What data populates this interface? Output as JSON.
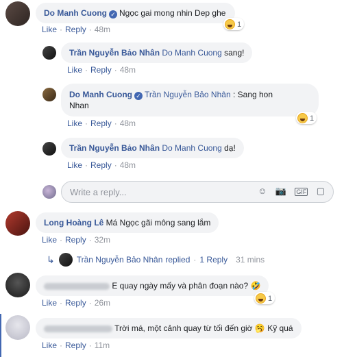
{
  "actions": {
    "like": "Like",
    "reply": "Reply"
  },
  "comments": [
    {
      "author": "Do Manh Cuong",
      "text": "Ngọc gai mong nhin Dep ghe",
      "time": "48m",
      "reaction_count": "1"
    },
    {
      "author": "Trần Nguyễn Bảo Nhân",
      "mention": "Do Manh Cuong",
      "text": "sang!",
      "time": "48m"
    },
    {
      "author": "Do Manh Cuong",
      "mention": "Trần Nguyễn Bảo Nhân",
      "text_line1": ": Sang hon",
      "text_line2": "Nhan",
      "time": "48m",
      "reaction_count": "1"
    },
    {
      "author": "Trần Nguyễn Bảo Nhân",
      "mention": "Do Manh Cuong",
      "text": "dạ!",
      "time": "48m"
    },
    {
      "author": "Long Hoàng Lê",
      "text": "Má Ngọc gãi mông sang lắm",
      "time": "32m"
    },
    {
      "text": "E quay ngày mấy và phân đoạn nào?",
      "time": "26m",
      "reaction_count": "1"
    },
    {
      "text": "Trời má, một cảnh quay từ tối đến giờ",
      "text_after": "Kỹ quá",
      "time": "11m"
    }
  ],
  "reply_box": {
    "placeholder": "Write a reply...",
    "icons": [
      "emoji-icon",
      "camera-icon",
      "gif-icon",
      "sticker-icon"
    ]
  },
  "replies_summary": {
    "author": "Trần Nguyễn Bảo Nhân",
    "verb": "replied",
    "separator": "·",
    "count_label": "1 Reply",
    "time": "31 mins"
  },
  "colors": {
    "link": "#385898",
    "bubble": "#f2f3f5",
    "muted": "#90949c"
  }
}
